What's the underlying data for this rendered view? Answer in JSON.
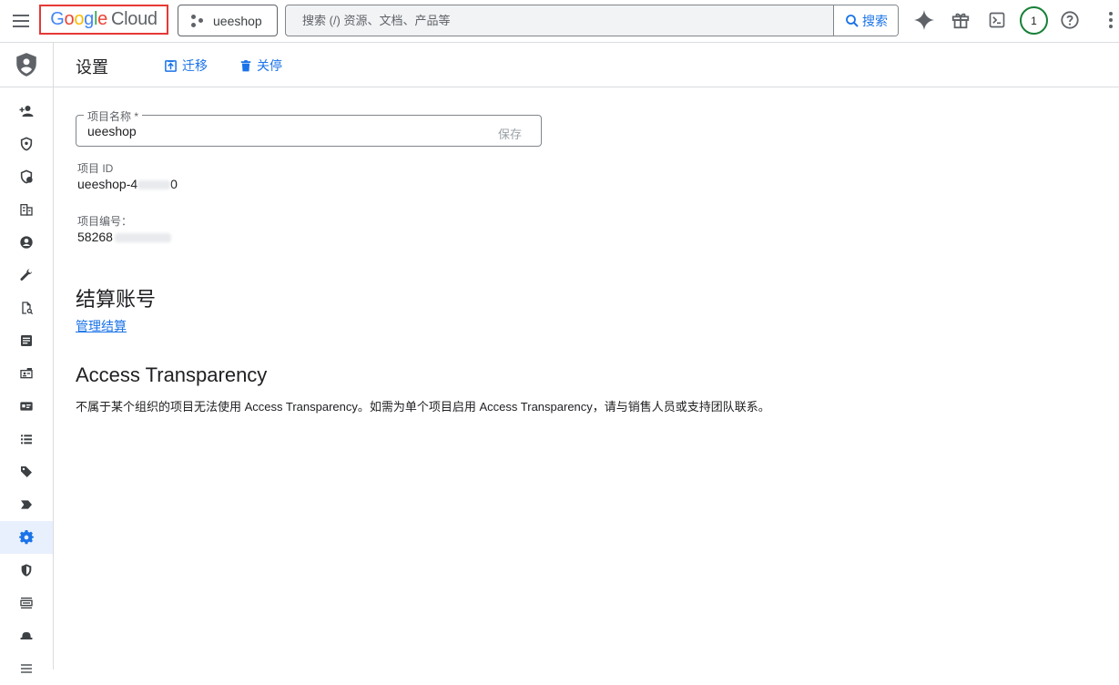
{
  "topbar": {
    "logo_google": "Google",
    "logo_cloud": "Cloud",
    "project_name": "ueeshop",
    "search_placeholder": "搜索 (/) 资源、文档、产品等",
    "search_button": "搜索",
    "avatar_initial": "1"
  },
  "header": {
    "title": "设置",
    "migrate_label": "迁移",
    "shutdown_label": "关停"
  },
  "settings": {
    "project_name_label": "项目名称 *",
    "project_name_value": "ueeshop",
    "save_label": "保存",
    "project_id_label": "项目 ID",
    "project_id_visible": "ueeshop-4",
    "project_id_tail": "0",
    "project_number_label": "项目编号：",
    "project_number_visible": "58268"
  },
  "billing": {
    "title": "结算账号",
    "manage_link": "管理结算"
  },
  "access_transparency": {
    "title": "Access Transparency",
    "description": "不属于某个组织的项目无法使用 Access Transparency。如需为单个项目启用 Access Transparency，请与销售人员或支持团队联系。"
  },
  "sidebar": {
    "items": [
      {
        "icon": "person-add-icon"
      },
      {
        "icon": "shield-icon"
      },
      {
        "icon": "shield-person-icon"
      },
      {
        "icon": "building-icon"
      },
      {
        "icon": "account-circle-icon"
      },
      {
        "icon": "wrench-icon"
      },
      {
        "icon": "document-search-icon"
      },
      {
        "icon": "article-icon"
      },
      {
        "icon": "badge-icon"
      },
      {
        "icon": "id-card-icon"
      },
      {
        "icon": "list-icon"
      },
      {
        "icon": "tag-icon"
      },
      {
        "icon": "label-arrow-icon"
      },
      {
        "icon": "gear-icon",
        "active": true
      },
      {
        "icon": "security-shield-icon"
      },
      {
        "icon": "view-list-icon"
      },
      {
        "icon": "hat-icon"
      },
      {
        "icon": "menu-lines-icon"
      }
    ]
  },
  "colors": {
    "accent": "#1a73e8",
    "logo_highlight": "#e53935",
    "avatar_ring": "#188038",
    "active_bg": "#e8f0fe"
  }
}
